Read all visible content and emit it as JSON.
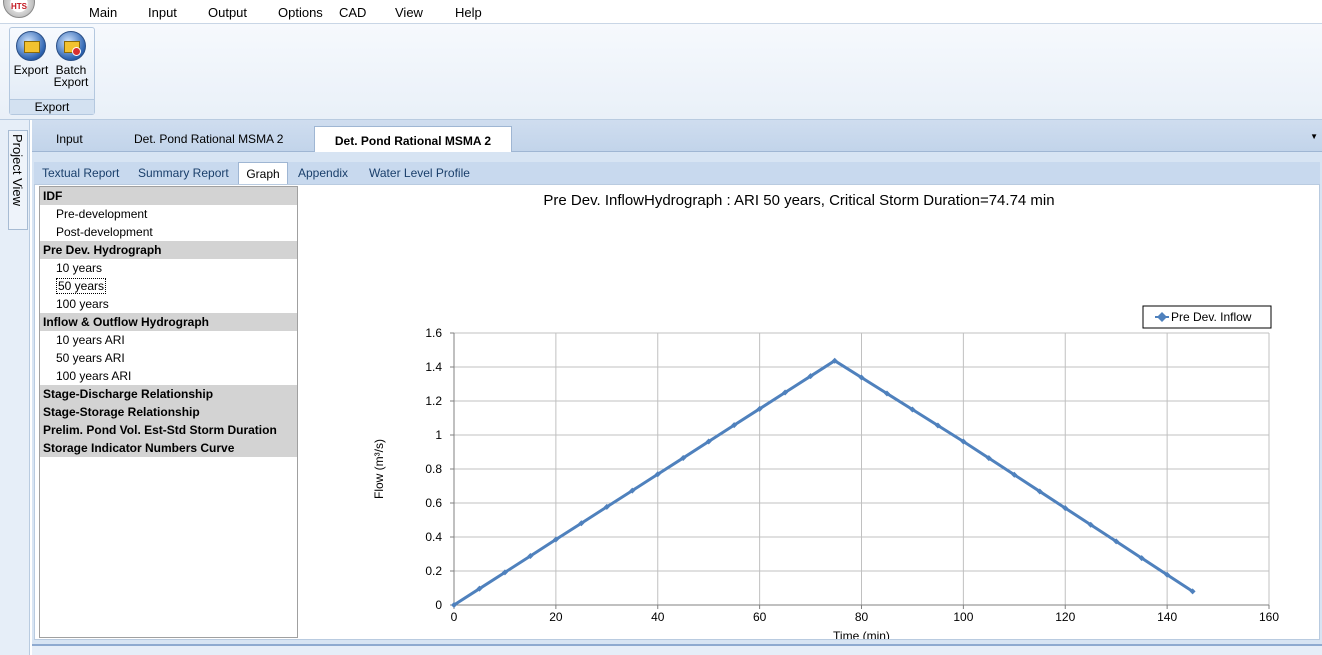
{
  "app": {
    "logo_text": "HTS"
  },
  "menu": {
    "items": [
      {
        "label": "Main"
      },
      {
        "label": "Input"
      },
      {
        "label": "Output"
      },
      {
        "label": "Options"
      },
      {
        "label": "CAD"
      },
      {
        "label": "View"
      },
      {
        "label": "Help"
      }
    ],
    "active": "Output"
  },
  "ribbon": {
    "export_label": "Export",
    "batch_export_label_1": "Batch",
    "batch_export_label_2": "Export",
    "group_label": "Export"
  },
  "sidebar": {
    "project_view_label": "Project View"
  },
  "doc_tabs": {
    "items": [
      {
        "label": "Input"
      },
      {
        "label": "Det. Pond Rational MSMA 2"
      },
      {
        "label": "Det. Pond Rational MSMA 2"
      }
    ],
    "active_index": 2
  },
  "sub_tabs": {
    "items": [
      {
        "label": "Textual Report"
      },
      {
        "label": "Summary Report"
      },
      {
        "label": "Graph"
      },
      {
        "label": "Appendix"
      },
      {
        "label": "Water Level Profile"
      }
    ],
    "active_index": 2
  },
  "tree": {
    "rows": [
      {
        "label": "IDF",
        "type": "hdr"
      },
      {
        "label": "Pre-development",
        "type": "item"
      },
      {
        "label": "Post-development",
        "type": "item"
      },
      {
        "label": "Pre Dev. Hydrograph",
        "type": "hdr"
      },
      {
        "label": "10 years",
        "type": "item"
      },
      {
        "label": "50 years",
        "type": "item",
        "selected": true
      },
      {
        "label": "100 years",
        "type": "item"
      },
      {
        "label": "Inflow & Outflow Hydrograph",
        "type": "hdr"
      },
      {
        "label": "10 years ARI",
        "type": "item"
      },
      {
        "label": "50 years ARI",
        "type": "item"
      },
      {
        "label": "100 years ARI",
        "type": "item"
      },
      {
        "label": "Stage-Discharge Relationship",
        "type": "hdr"
      },
      {
        "label": "Stage-Storage Relationship",
        "type": "hdr"
      },
      {
        "label": "Prelim. Pond Vol. Est-Std Storm Duration",
        "type": "hdr"
      },
      {
        "label": "Storage Indicator Numbers Curve",
        "type": "hdr"
      }
    ]
  },
  "colors": {
    "series": "#4f81bd",
    "grid": "#c0c0c0",
    "tree_header": "#d3d3d3"
  },
  "chart_data": {
    "type": "line",
    "title": "Pre Dev. InflowHydrograph : ARI 50 years, Critical Storm Duration=74.74 min",
    "xlabel": "Time (min)",
    "ylabel": "Flow (m³/s)",
    "xlim": [
      0,
      160
    ],
    "ylim": [
      0,
      1.6
    ],
    "xticks": [
      0,
      20,
      40,
      60,
      80,
      100,
      120,
      140,
      160
    ],
    "yticks": [
      0,
      0.2,
      0.4,
      0.6,
      0.8,
      1,
      1.2,
      1.4,
      1.6
    ],
    "grid": true,
    "legend_position": "top-right",
    "series": [
      {
        "name": "Pre Dev. Inflow",
        "x": [
          0,
          5,
          10,
          15,
          20,
          25,
          30,
          35,
          40,
          45,
          50,
          55,
          60,
          65,
          70,
          74.74,
          80,
          85,
          90,
          95,
          100,
          105,
          110,
          115,
          120,
          125,
          130,
          135,
          140,
          145
        ],
        "y": [
          0,
          0.096,
          0.192,
          0.288,
          0.385,
          0.481,
          0.577,
          0.673,
          0.769,
          0.865,
          0.962,
          1.058,
          1.154,
          1.25,
          1.346,
          1.437,
          1.338,
          1.244,
          1.15,
          1.056,
          0.962,
          0.864,
          0.766,
          0.668,
          0.57,
          0.472,
          0.374,
          0.276,
          0.178,
          0.08
        ]
      }
    ]
  }
}
